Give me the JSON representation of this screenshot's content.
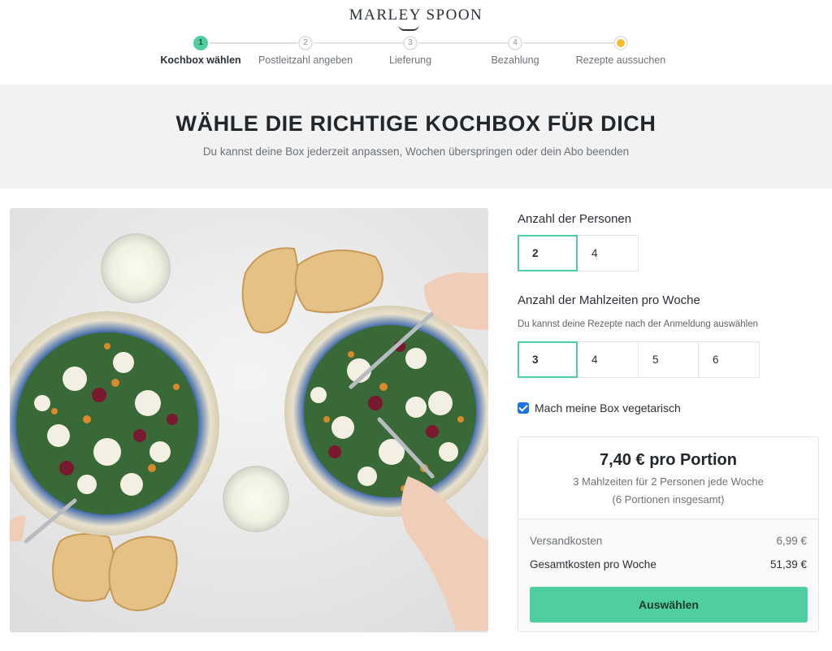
{
  "brand": {
    "name": "MARLEY SPOON"
  },
  "steps": [
    {
      "num": "1",
      "label": "Kochbox wählen"
    },
    {
      "num": "2",
      "label": "Postleitzahl angeben"
    },
    {
      "num": "3",
      "label": "Lieferung"
    },
    {
      "num": "4",
      "label": "Bezahlung"
    },
    {
      "num": "",
      "label": "Rezepte aussuchen"
    }
  ],
  "banner": {
    "title": "WÄHLE DIE RICHTIGE KOCHBOX FÜR DICH",
    "subtitle": "Du kannst deine Box jederzeit anpassen, Wochen überspringen oder dein Abo beenden"
  },
  "persons": {
    "title": "Anzahl der Personen",
    "options": [
      "2",
      "4"
    ],
    "selected": "2"
  },
  "meals": {
    "title": "Anzahl der Mahlzeiten pro Woche",
    "subtitle": "Du kannst deine Rezepte nach der Anmeldung auswählen",
    "options": [
      "3",
      "4",
      "5",
      "6"
    ],
    "selected": "3"
  },
  "vegetarian": {
    "label": "Mach meine Box vegetarisch",
    "checked": true
  },
  "price": {
    "per_portion": "7,40 € pro Portion",
    "detail": "3 Mahlzeiten für 2 Personen jede Woche",
    "total_portions": "(6 Portionen insgesamt)",
    "shipping_label": "Versandkosten",
    "shipping_value": "6,99 €",
    "total_label": "Gesamtkosten pro Woche",
    "total_value": "51,39 €",
    "cta": "Auswählen"
  },
  "colors": {
    "accent": "#4fcea0",
    "checkbox": "#1a73e8",
    "pending_step": "#f4be2a",
    "banner_bg": "#f2f2f2"
  }
}
